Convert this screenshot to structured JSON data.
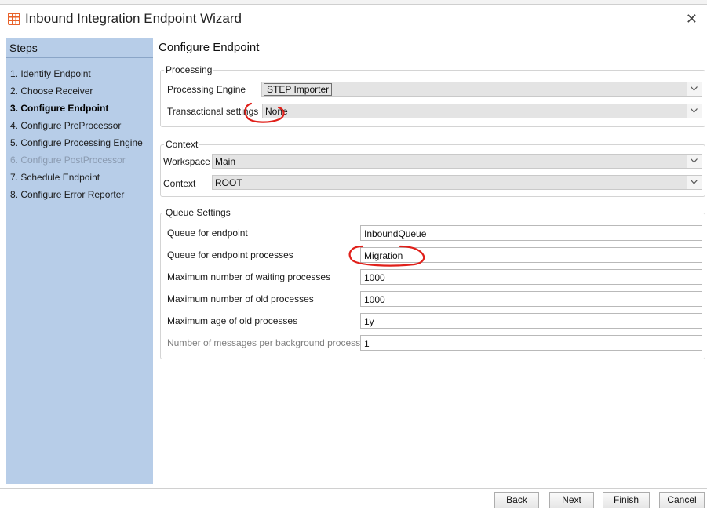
{
  "window": {
    "title": "Inbound Integration Endpoint Wizard",
    "close_icon": "close-icon",
    "app_icon": "grid-app-icon",
    "app_icon_color": "#e8622a"
  },
  "sidebar": {
    "title": "Steps",
    "background": "#b7cde8",
    "items": [
      {
        "label": "1. Identify Endpoint",
        "state": "normal"
      },
      {
        "label": "2. Choose Receiver",
        "state": "normal"
      },
      {
        "label": "3. Configure Endpoint",
        "state": "active"
      },
      {
        "label": "4. Configure PreProcessor",
        "state": "normal"
      },
      {
        "label": "5. Configure Processing Engine",
        "state": "normal"
      },
      {
        "label": "6. Configure PostProcessor",
        "state": "disabled"
      },
      {
        "label": "7. Schedule Endpoint",
        "state": "normal"
      },
      {
        "label": "8. Configure Error Reporter",
        "state": "normal"
      }
    ]
  },
  "main": {
    "title": "Configure Endpoint",
    "processing": {
      "legend": "Processing",
      "engine_label": "Processing Engine",
      "engine_value": "STEP Importer",
      "transactional_label": "Transactional settings",
      "transactional_value": "None"
    },
    "context": {
      "legend": "Context",
      "workspace_label": "Workspace",
      "workspace_value": "Main",
      "context_label": "Context",
      "context_value": "ROOT"
    },
    "queue": {
      "legend": "Queue Settings",
      "rows": [
        {
          "label": "Queue for endpoint",
          "value": "InboundQueue",
          "enabled": true
        },
        {
          "label": "Queue for endpoint processes",
          "value": "Migration",
          "enabled": true
        },
        {
          "label": "Maximum number of waiting processes",
          "value": "1000",
          "enabled": true
        },
        {
          "label": "Maximum number of old processes",
          "value": "1000",
          "enabled": true
        },
        {
          "label": "Maximum age of old processes",
          "value": "1y",
          "enabled": true
        },
        {
          "label": "Number of messages per background process",
          "value": "1",
          "enabled": false
        }
      ]
    }
  },
  "annotations": {
    "color": "#e0201a"
  },
  "footer": {
    "back": "Back",
    "next": "Next",
    "finish": "Finish",
    "cancel": "Cancel"
  }
}
